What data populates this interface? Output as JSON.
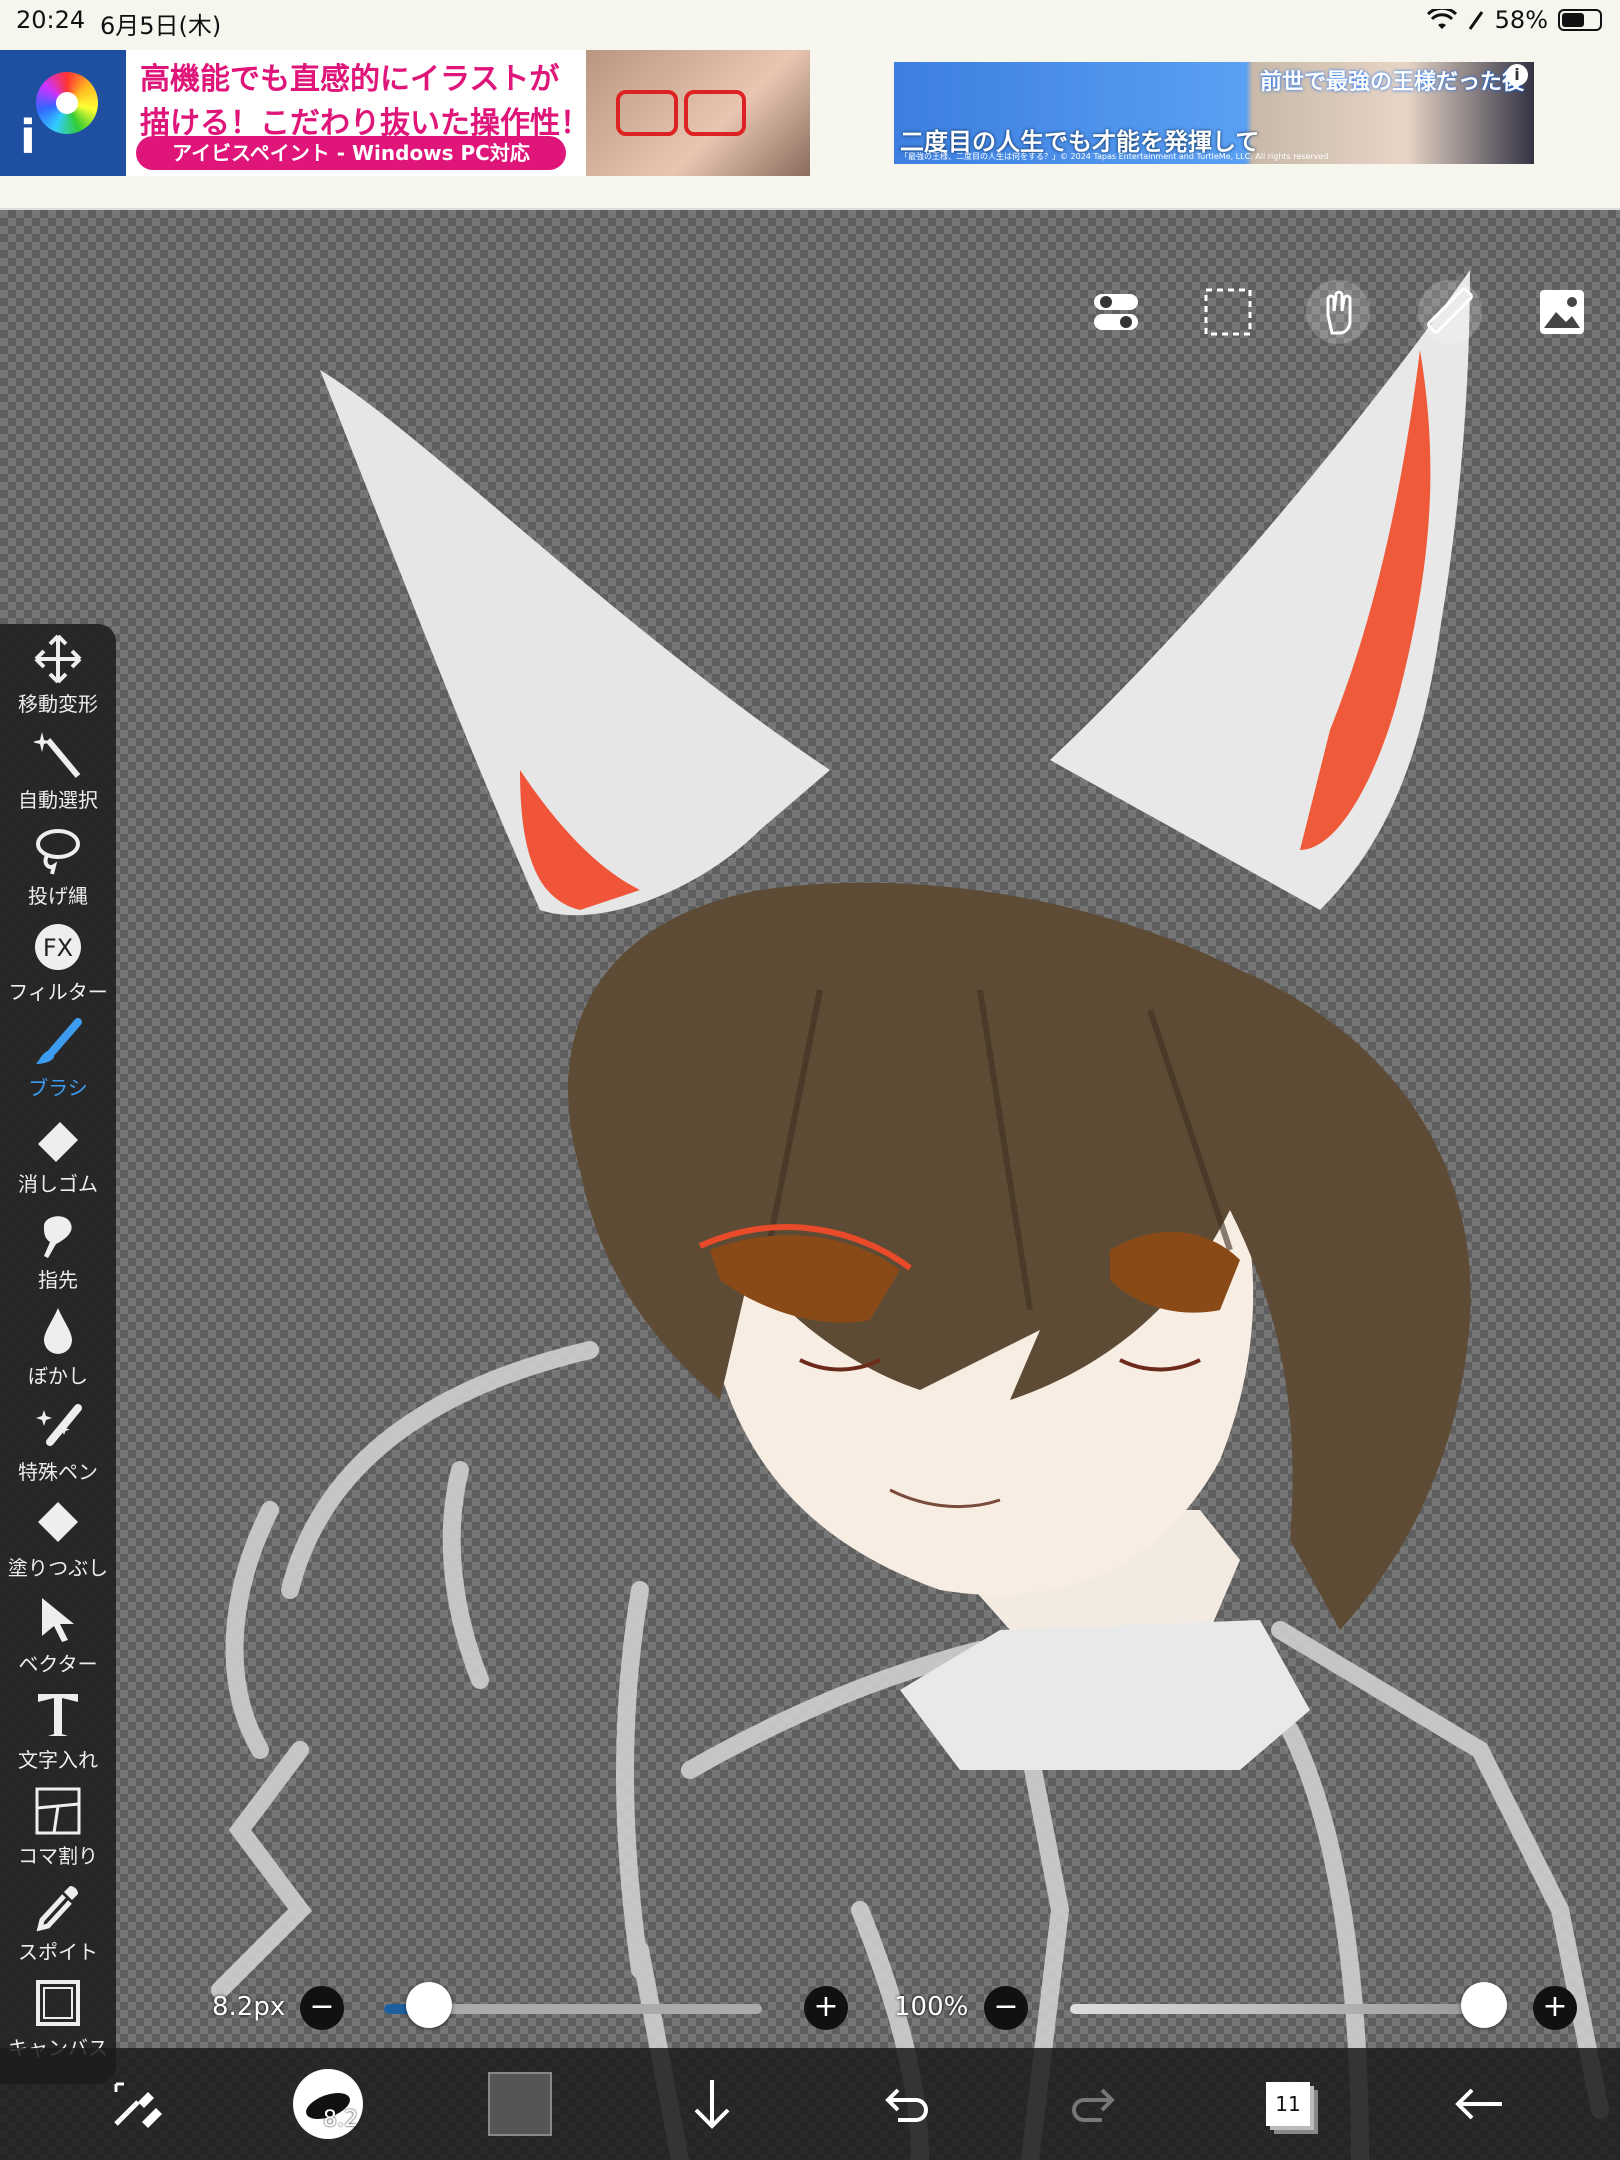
{
  "status_bar": {
    "time": "20:24",
    "date": "6月5日(木)",
    "battery": "58%"
  },
  "ad_left": {
    "line1": "高機能でも直感的にイラストが",
    "line2": "描ける！こだわり抜いた操作性！",
    "pill": "アイビスペイント - Windows PC対応"
  },
  "ad_right": {
    "title": "前世で最強の王様だった後",
    "subtitle": "二度目の人生でも才能を発揮して",
    "fine_print": "「最強の王様、二度目の人生は何をする？」© 2024 Tapas Entertainment and TurtleMe, LLC. All rights reserved",
    "info": "i"
  },
  "tools": [
    {
      "label": "移動変形",
      "icon": "move-transform-icon"
    },
    {
      "label": "自動選択",
      "icon": "magic-wand-icon"
    },
    {
      "label": "投げ縄",
      "icon": "lasso-icon"
    },
    {
      "label": "フィルター",
      "icon": "filter-fx-icon"
    },
    {
      "label": "ブラシ",
      "icon": "brush-icon"
    },
    {
      "label": "消しゴム",
      "icon": "eraser-icon"
    },
    {
      "label": "指先",
      "icon": "smudge-finger-icon"
    },
    {
      "label": "ぼかし",
      "icon": "blur-drop-icon"
    },
    {
      "label": "特殊ペン",
      "icon": "special-pen-icon"
    },
    {
      "label": "塗りつぶし",
      "icon": "fill-bucket-icon"
    },
    {
      "label": "ベクター",
      "icon": "vector-cursor-icon"
    },
    {
      "label": "文字入れ",
      "icon": "text-icon"
    },
    {
      "label": "コマ割り",
      "icon": "frame-divider-icon"
    },
    {
      "label": "スポイト",
      "icon": "eyedropper-icon"
    },
    {
      "label": "キャンバス",
      "icon": "canvas-icon"
    }
  ],
  "selected_tool": "ブラシ",
  "brush_size": {
    "label": "8.2px",
    "fraction": 0.12
  },
  "opacity": {
    "label": "100%",
    "fraction": 1.0
  },
  "bottom": {
    "brush_preview_size": "8.2",
    "layer_count": "11"
  },
  "colors": {
    "accent": "#3d9cf0",
    "current_color": "#555555"
  }
}
